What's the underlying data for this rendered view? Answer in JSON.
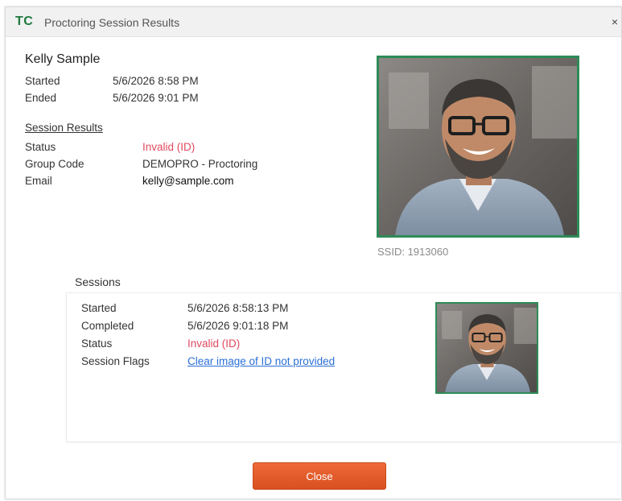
{
  "window": {
    "brand": "TC",
    "title": "Proctoring Session Results",
    "close_glyph": "×"
  },
  "person": {
    "name": "Kelly Sample",
    "started_label": "Started",
    "started_value": "5/6/2026 8:58 PM",
    "ended_label": "Ended",
    "ended_value": "5/6/2026 9:01 PM"
  },
  "session_results": {
    "heading": "Session Results",
    "status_label": "Status",
    "status_value": "Invalid (ID)",
    "group_code_label": "Group Code",
    "group_code_value": "DEMOPRO - Proctoring",
    "email_label": "Email",
    "email_value": "kelly@sample.com"
  },
  "photo": {
    "ssid": "SSID: 1913060"
  },
  "sessions": {
    "heading": "Sessions",
    "started_label": "Started",
    "started_value": "5/6/2026 8:58:13 PM",
    "completed_label": "Completed",
    "completed_value": "5/6/2026 9:01:18 PM",
    "status_label": "Status",
    "status_value": "Invalid (ID)",
    "flags_label": "Session Flags",
    "flags_value": "Clear image of ID not provided"
  },
  "footer": {
    "close_label": "Close"
  },
  "colors": {
    "brand_green": "#1f7a3d",
    "photo_border": "#2e8b57",
    "invalid_red": "#e0495f",
    "link_blue": "#2a6fd6",
    "close_button": "#e45f2c"
  }
}
